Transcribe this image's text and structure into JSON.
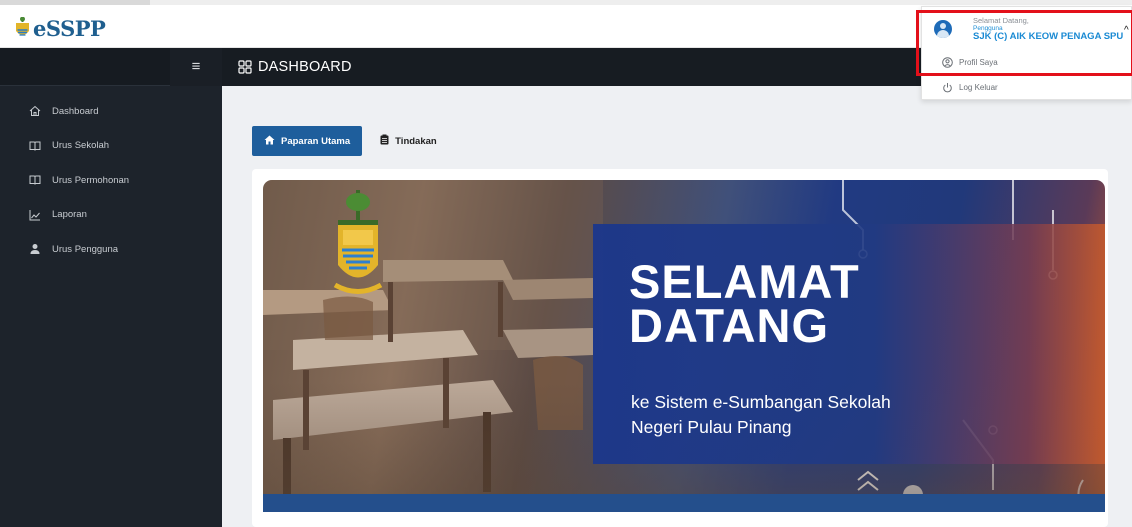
{
  "app": {
    "logo_text": "eSSPP"
  },
  "sidebar": {
    "menu_icon": "hamburger-icon",
    "items": [
      {
        "label": "Dashboard",
        "icon": "home-icon"
      },
      {
        "label": "Urus Sekolah",
        "icon": "book-icon"
      },
      {
        "label": "Urus Permohonan",
        "icon": "book-icon"
      },
      {
        "label": "Laporan",
        "icon": "line-chart-icon"
      },
      {
        "label": "Urus Pengguna",
        "icon": "user-icon"
      }
    ]
  },
  "header": {
    "title": "DASHBOARD",
    "icon": "grid-icon"
  },
  "tabs": [
    {
      "label": "Paparan Utama",
      "icon": "home-icon",
      "active": true
    },
    {
      "label": "Tindakan",
      "icon": "clipboard-icon",
      "active": false
    }
  ],
  "banner": {
    "title_line1": "SELAMAT",
    "title_line2": "DATANG",
    "subtitle_line1": "ke Sistem e-Sumbangan Sekolah",
    "subtitle_line2": "Negeri Pulau Pinang"
  },
  "user_menu": {
    "greeting": "Selamat Datang,",
    "role": "Pengguna",
    "school": "SJK (C) AIK KEOW PENAGA SPU",
    "items": [
      {
        "label": "Profil Saya",
        "icon": "user-circle-icon"
      },
      {
        "label": "Log Keluar",
        "icon": "power-icon"
      }
    ]
  },
  "colors": {
    "sidebar_bg": "#1d232b",
    "accent": "#1e5e9c",
    "school_text": "#1a8ad3",
    "highlight": "#e3101a"
  }
}
